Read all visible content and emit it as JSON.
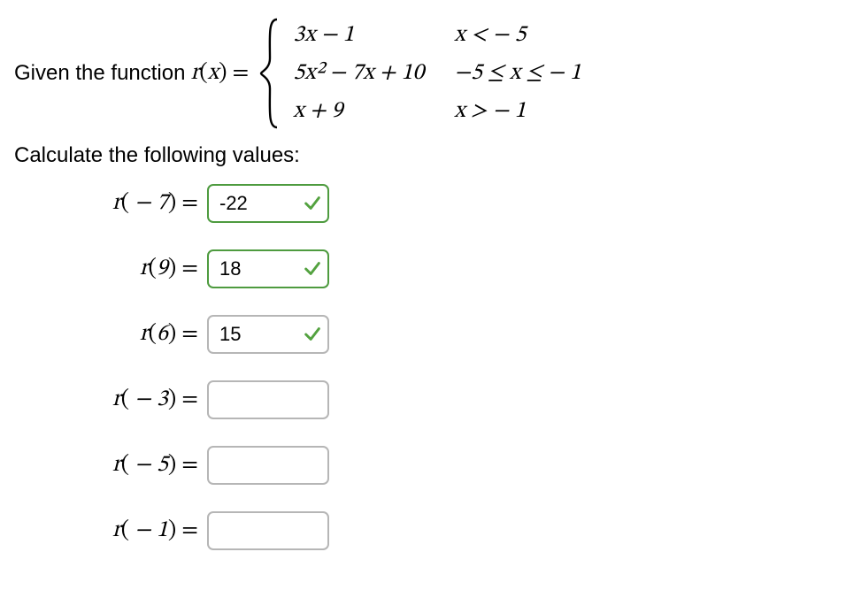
{
  "prompt": {
    "prefix": "Given the function ",
    "fn_name": "r",
    "fn_var": "x",
    "equals": " = "
  },
  "piecewise": {
    "rows": [
      {
        "expr": "3x − 1",
        "cond": "x <  − 5"
      },
      {
        "expr": "5x² − 7x + 10",
        "cond": "−5 ≤ x ≤  − 1"
      },
      {
        "expr": "x + 9",
        "cond": "x >  − 1"
      }
    ]
  },
  "instruction": "Calculate the following values:",
  "answers": [
    {
      "arg": " − 7",
      "value": "-22",
      "status": "correct"
    },
    {
      "arg": "9",
      "value": "18",
      "status": "correct"
    },
    {
      "arg": "6",
      "value": "15",
      "status": "correct"
    },
    {
      "arg": " − 3",
      "value": "",
      "status": "blank"
    },
    {
      "arg": " − 5",
      "value": "",
      "status": "blank"
    },
    {
      "arg": " − 1",
      "value": "",
      "status": "blank"
    }
  ],
  "colors": {
    "correct_border": "#4e9b3f",
    "neutral_border": "#b6b6b6",
    "check_green": "#53a23f"
  }
}
